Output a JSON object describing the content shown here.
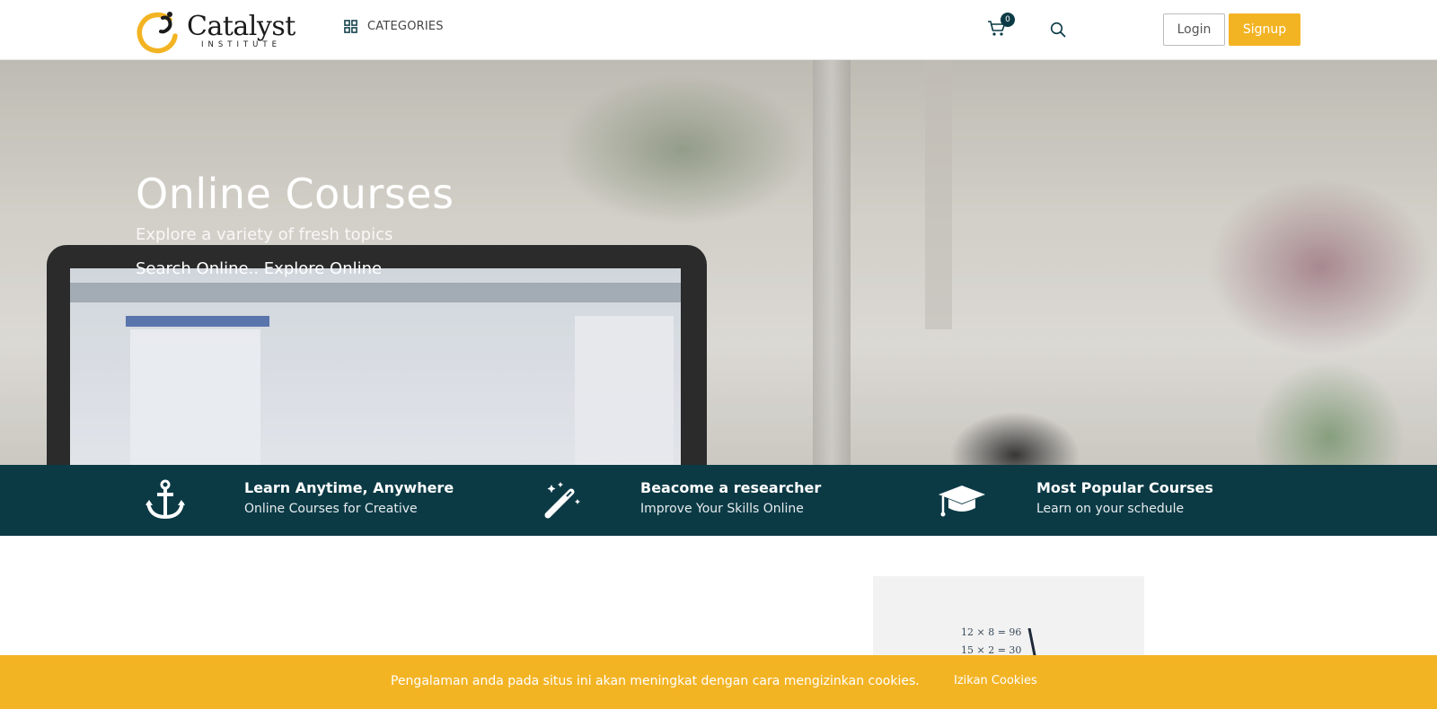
{
  "brand": {
    "name": "Catalyst",
    "subtitle": "INSTITUTE",
    "accent": "#f3b424",
    "dark": "#0b3a45"
  },
  "header": {
    "categories_label": "CATEGORIES",
    "categories_icon": "grid-icon",
    "cart_icon": "cart-icon",
    "cart_count": "0",
    "search_icon": "search-icon",
    "login_label": "Login",
    "signup_label": "Signup"
  },
  "hero": {
    "title": "Online Courses",
    "subtitle": "Explore a variety of fresh topics",
    "tagline": "Search Online.. Explore Online"
  },
  "features": [
    {
      "icon": "anchor-icon",
      "title": "Learn Anytime, Anywhere",
      "desc": "Online Courses for Creative"
    },
    {
      "icon": "magic-wand-icon",
      "title": "Beacome a researcher",
      "desc": "Improve Your Skills Online"
    },
    {
      "icon": "graduation-cap-icon",
      "title": "Most Popular Courses",
      "desc": "Learn on your schedule"
    }
  ],
  "math_card": {
    "lines": [
      "12 × 8 = 96",
      "15 × 2 = 30"
    ]
  },
  "cookie": {
    "message": "Pengalaman anda pada situs ini akan meningkat dengan cara mengizinkan cookies.",
    "button_label": "Izikan Cookies"
  }
}
